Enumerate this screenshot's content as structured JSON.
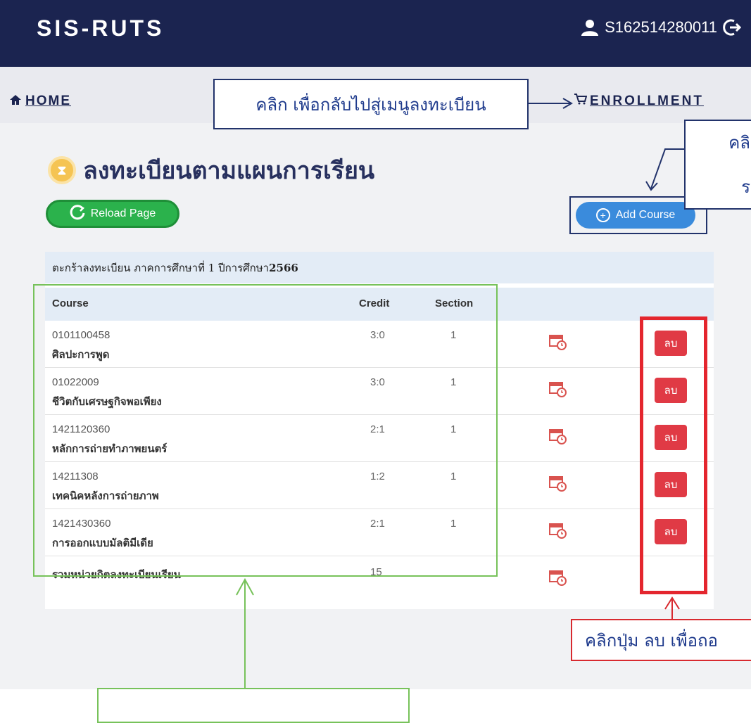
{
  "topbar": {
    "brand": "SIS-RUTS",
    "user_id": "S162514280011",
    "user_icon": "user-icon",
    "logout_icon": "logout-icon"
  },
  "nav": {
    "home_label": "HOME",
    "home_icon": "home-icon",
    "enrollment_label": "ENROLLMENT",
    "enrollment_icon": "cart-icon"
  },
  "page": {
    "title": "ลงทะเบียนตามแผนการเรียน",
    "reload_label": "Reload Page",
    "add_course_label": "Add Course"
  },
  "cart": {
    "caption_prefix": "ตะกร้าลงทะเบียน ภาคการศึกษาที่ 1 ปีการศึกษา ",
    "caption_year": "2566",
    "headers": {
      "course": "Course",
      "credit": "Credit",
      "section": "Section"
    },
    "rows": [
      {
        "code": "0101100458",
        "name": "ศิลปะการพูด",
        "credit": "3:0",
        "section": "1",
        "delete_label": "ลบ"
      },
      {
        "code": "01022009",
        "name": "ชีวิตกับเศรษฐกิจพอเพียง",
        "credit": "3:0",
        "section": "1",
        "delete_label": "ลบ"
      },
      {
        "code": "1421120360",
        "name": "หลักการถ่ายทำภาพยนตร์",
        "credit": "2:1",
        "section": "1",
        "delete_label": "ลบ"
      },
      {
        "code": "14211308",
        "name": "เทคนิคหลังการถ่ายภาพ",
        "credit": "1:2",
        "section": "1",
        "delete_label": "ลบ"
      },
      {
        "code": "1421430360",
        "name": "การออกแบบมัลติมีเดีย",
        "credit": "2:1",
        "section": "1",
        "delete_label": "ลบ"
      }
    ],
    "total": {
      "label": "รวมหน่วยกิตลงทะเบียนเรียน",
      "credit": "15"
    }
  },
  "annotations": {
    "back_to_menu": "คลิก เพื่อกลับไปสู่เมนูลงทะเบียน",
    "add_note_line1": "คลิ",
    "add_note_line2": "ร",
    "delete_note": "คลิกปุ่ม ลบ เพื่อถอ"
  },
  "colors": {
    "topbar": "#1b2450",
    "reload": "#2bb24c",
    "add_course": "#3a8bdc",
    "delete": "#e03a45",
    "annotation_red": "#e4262e",
    "annotation_green": "#77c25a"
  }
}
